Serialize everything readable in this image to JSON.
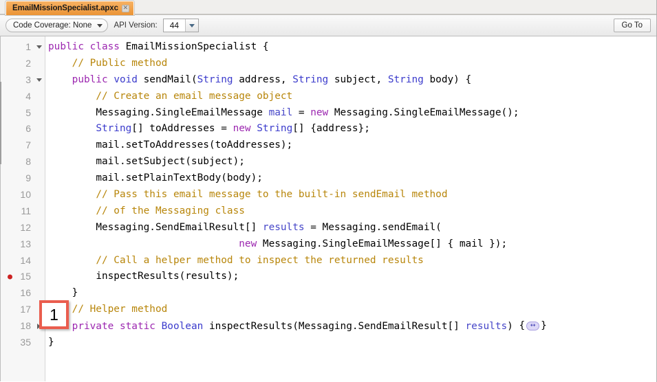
{
  "window": {
    "tab": {
      "label": "EmailMissionSpecialist.apxc",
      "close_glyph": "✕"
    }
  },
  "toolbar": {
    "code_coverage_label": "Code Coverage: None",
    "api_version_label": "API Version:",
    "api_version_value": "44",
    "go_to_label": "Go To"
  },
  "annotation": {
    "step_number": "1"
  },
  "editor": {
    "fold_marker_glyph": "↔",
    "lines": [
      {
        "num": "1",
        "fold": "down",
        "breakpoint": false,
        "indent": 0,
        "tokens": [
          {
            "t": "kw",
            "s": "public class"
          },
          {
            "t": "pl",
            "s": " EmailMissionSpecialist {"
          }
        ]
      },
      {
        "num": "2",
        "fold": "none",
        "breakpoint": false,
        "indent": 1,
        "tokens": [
          {
            "t": "com",
            "s": "// Public method"
          }
        ]
      },
      {
        "num": "3",
        "fold": "down",
        "breakpoint": false,
        "indent": 1,
        "tokens": [
          {
            "t": "kw",
            "s": "public "
          },
          {
            "t": "type",
            "s": "void"
          },
          {
            "t": "pl",
            "s": " sendMail("
          },
          {
            "t": "type",
            "s": "String"
          },
          {
            "t": "pl",
            "s": " address, "
          },
          {
            "t": "type",
            "s": "String"
          },
          {
            "t": "pl",
            "s": " subject, "
          },
          {
            "t": "type",
            "s": "String"
          },
          {
            "t": "pl",
            "s": " body) {"
          }
        ]
      },
      {
        "num": "4",
        "fold": "none",
        "breakpoint": false,
        "indent": 2,
        "tokens": [
          {
            "t": "com",
            "s": "// Create an email message object"
          }
        ]
      },
      {
        "num": "5",
        "fold": "none",
        "breakpoint": false,
        "indent": 2,
        "tokens": [
          {
            "t": "pl",
            "s": "Messaging.SingleEmailMessage "
          },
          {
            "t": "var",
            "s": "mail"
          },
          {
            "t": "pl",
            "s": " = "
          },
          {
            "t": "kw",
            "s": "new"
          },
          {
            "t": "pl",
            "s": " Messaging.SingleEmailMessage();"
          }
        ]
      },
      {
        "num": "6",
        "fold": "none",
        "breakpoint": false,
        "indent": 2,
        "tokens": [
          {
            "t": "type",
            "s": "String"
          },
          {
            "t": "pl",
            "s": "[] toAddresses = "
          },
          {
            "t": "kw",
            "s": "new"
          },
          {
            "t": "pl",
            "s": " "
          },
          {
            "t": "type",
            "s": "String"
          },
          {
            "t": "pl",
            "s": "[] {address};"
          }
        ]
      },
      {
        "num": "7",
        "fold": "none",
        "breakpoint": false,
        "indent": 2,
        "tokens": [
          {
            "t": "pl",
            "s": "mail.setToAddresses(toAddresses);"
          }
        ]
      },
      {
        "num": "8",
        "fold": "none",
        "breakpoint": false,
        "indent": 2,
        "tokens": [
          {
            "t": "pl",
            "s": "mail.setSubject(subject);"
          }
        ]
      },
      {
        "num": "9",
        "fold": "none",
        "breakpoint": false,
        "indent": 2,
        "tokens": [
          {
            "t": "pl",
            "s": "mail.setPlainTextBody(body);"
          }
        ]
      },
      {
        "num": "10",
        "fold": "none",
        "breakpoint": false,
        "indent": 2,
        "tokens": [
          {
            "t": "com",
            "s": "// Pass this email message to the built-in sendEmail method"
          }
        ]
      },
      {
        "num": "11",
        "fold": "none",
        "breakpoint": false,
        "indent": 2,
        "tokens": [
          {
            "t": "com",
            "s": "// of the Messaging class"
          }
        ]
      },
      {
        "num": "12",
        "fold": "none",
        "breakpoint": false,
        "indent": 2,
        "tokens": [
          {
            "t": "pl",
            "s": "Messaging.SendEmailResult[] "
          },
          {
            "t": "var",
            "s": "results"
          },
          {
            "t": "pl",
            "s": " = Messaging.sendEmail("
          }
        ]
      },
      {
        "num": "13",
        "fold": "none",
        "breakpoint": false,
        "indent": 8,
        "tokens": [
          {
            "t": "kw",
            "s": "new"
          },
          {
            "t": "pl",
            "s": " Messaging.SingleEmailMessage[] { mail });"
          }
        ]
      },
      {
        "num": "14",
        "fold": "none",
        "breakpoint": false,
        "indent": 2,
        "tokens": [
          {
            "t": "com",
            "s": "// Call a helper method to inspect the returned results"
          }
        ]
      },
      {
        "num": "15",
        "fold": "none",
        "breakpoint": true,
        "indent": 2,
        "tokens": [
          {
            "t": "pl",
            "s": "inspectResults(results);"
          }
        ]
      },
      {
        "num": "16",
        "fold": "none",
        "breakpoint": false,
        "indent": 1,
        "tokens": [
          {
            "t": "pl",
            "s": "}"
          }
        ]
      },
      {
        "num": "17",
        "fold": "none",
        "breakpoint": false,
        "indent": 1,
        "tokens": [
          {
            "t": "com",
            "s": "// Helper method"
          }
        ]
      },
      {
        "num": "18",
        "fold": "right",
        "breakpoint": false,
        "indent": 1,
        "folded_tail": true,
        "tokens": [
          {
            "t": "kw",
            "s": "private static "
          },
          {
            "t": "type",
            "s": "Boolean"
          },
          {
            "t": "pl",
            "s": " inspectResults(Messaging.SendEmailResult[] "
          },
          {
            "t": "var",
            "s": "results"
          },
          {
            "t": "pl",
            "s": ") "
          }
        ]
      },
      {
        "num": "35",
        "fold": "none",
        "breakpoint": false,
        "indent": 0,
        "tokens": [
          {
            "t": "pl",
            "s": "}"
          }
        ]
      }
    ]
  },
  "colors": {
    "tab_accent": "#f2a14b",
    "keyword": "#9c27b0",
    "type": "#3b3bcc",
    "variable": "#4646c8",
    "comment": "#b8860b",
    "breakpoint": "#cc2222",
    "callout_border": "#ea5d4e"
  }
}
